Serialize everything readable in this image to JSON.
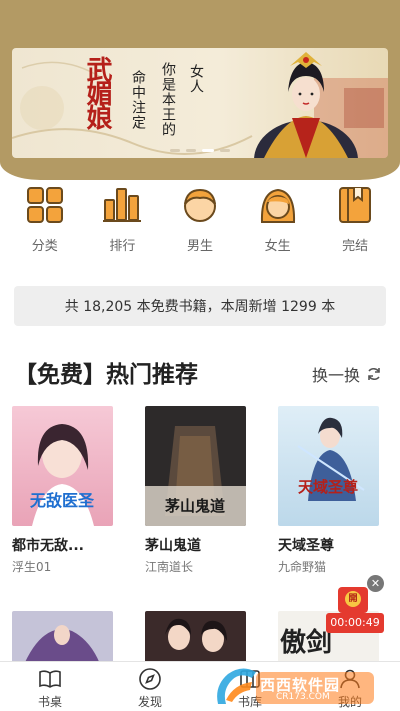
{
  "banner": {
    "title": "武媚娘",
    "text_col1": "命中注定",
    "text_col2": "你是本王的",
    "text_col3": "女人",
    "dots": 4,
    "active_dot": 2
  },
  "categories": [
    {
      "label": "分类",
      "icon": "grid-icon"
    },
    {
      "label": "排行",
      "icon": "bar-chart-icon"
    },
    {
      "label": "男生",
      "icon": "male-avatar-icon"
    },
    {
      "label": "女生",
      "icon": "female-avatar-icon"
    },
    {
      "label": "完结",
      "icon": "book-complete-icon"
    }
  ],
  "stats_text": "共 18,205 本免费书籍，本周新增 1299 本",
  "section": {
    "title": "【免费】热门推荐",
    "refresh_label": "换一换"
  },
  "books": [
    {
      "title": "都市无敌...",
      "author": "浮生01",
      "cover_text": "无敌医圣"
    },
    {
      "title": "茅山鬼道",
      "author": "江南道长",
      "cover_text": "茅山鬼道"
    },
    {
      "title": "天域圣尊",
      "author": "九命野猫",
      "cover_text": "天域圣尊"
    },
    {
      "title": "",
      "author": "",
      "cover_text": ""
    },
    {
      "title": "",
      "author": "",
      "cover_text": ""
    },
    {
      "title": "",
      "author": "",
      "cover_text": "傲剑"
    }
  ],
  "red_packet": {
    "badge": "開",
    "timer": "00:00:49"
  },
  "nav": [
    {
      "label": "书桌",
      "icon": "book-open-icon"
    },
    {
      "label": "发现",
      "icon": "compass-icon"
    },
    {
      "label": "书库",
      "icon": "library-icon"
    },
    {
      "label": "我的",
      "icon": "user-icon"
    }
  ],
  "watermark": {
    "text": "西西软件园",
    "sub": "CR173.COM"
  },
  "colors": {
    "gold": "#c8a15c",
    "banner_bg": "#b39a64",
    "icon_orange": "#f3a33c",
    "red": "#e43a2f"
  }
}
